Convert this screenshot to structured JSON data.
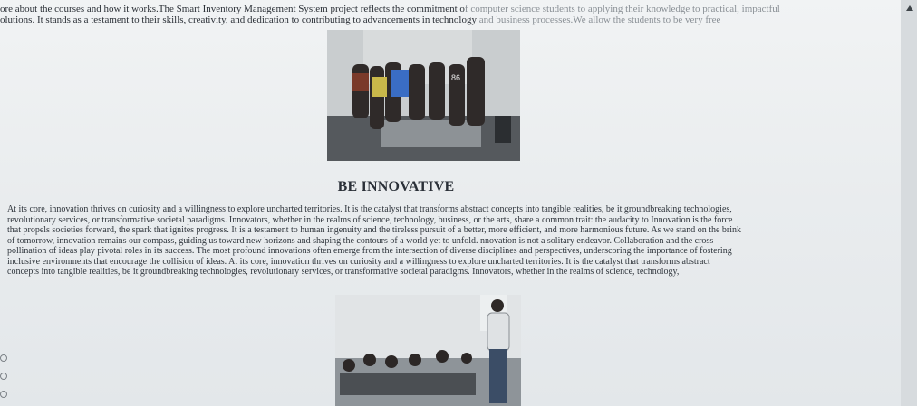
{
  "intro": {
    "line1_main": "ore about the courses and how it works.The Smart Inventory Management System project reflects the commitment o",
    "line1_faded": "f computer science students to applying their knowledge to practical, impactful",
    "line2_main": "olutions. It stands as a testament to their skills, creativity, and dedication to contributing to advancements in technology",
    "line2_faded": " and business processes.We allow the students to be very free"
  },
  "heading": "BE INNOVATIVE",
  "body_lines": [
    "At its core, innovation thrives on curiosity and a willingness to explore uncharted territories. It is the catalyst that transforms abstract concepts into tangible realities, be it groundbreaking technologies,",
    "revolutionary services, or transformative societal paradigms. Innovators, whether in the realms of science, technology, business, or the arts, share a common trait: the audacity to Innovation is the force",
    "that propels societies forward, the spark that ignites progress. It is a testament to human ingenuity and the tireless pursuit of a better, more efficient, and more harmonious future. As we stand on the brink",
    "of tomorrow, innovation remains our compass, guiding us toward new horizons and shaping the contours of a world yet to unfold. nnovation is not a solitary endeavor. Collaboration and the cross-",
    "pollination of ideas play pivotal roles in its success. The most profound innovations often emerge from the intersection of diverse disciplines and perspectives, underscoring the importance of fostering",
    "inclusive environments that encourage the collision of ideas. At its core, innovation thrives on curiosity and a willingness to explore uncharted territories. It is the catalyst that transforms abstract",
    "concepts into tangible realities, be it groundbreaking technologies, revolutionary services, or transformative societal paradigms. Innovators, whether in the realms of science, technology,"
  ],
  "photos": {
    "group_photo_label": "86",
    "group_photo_alt": "group photo",
    "presentation_photo_alt": "presentation photo"
  },
  "colors": {
    "text": "#2a2f36",
    "faded_text": "#8a9096",
    "background": "#eceff1"
  }
}
